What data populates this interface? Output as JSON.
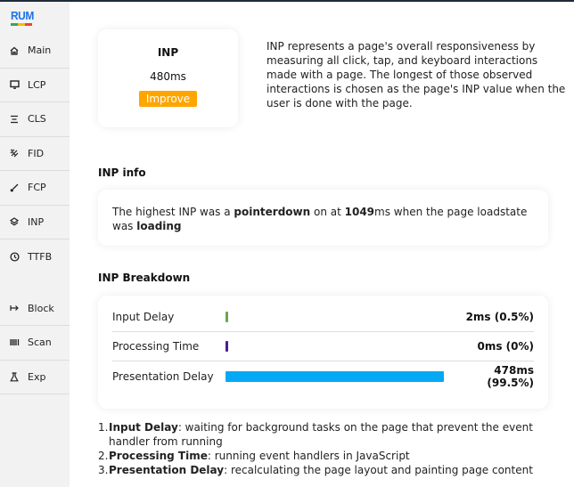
{
  "app": {
    "logo": "RUM",
    "logo_colors": [
      "#34a853",
      "#fbbc05",
      "#ea4335"
    ]
  },
  "sidebar": {
    "items": [
      {
        "label": "Main",
        "icon": "home-icon"
      },
      {
        "label": "LCP",
        "icon": "monitor-icon"
      },
      {
        "label": "CLS",
        "icon": "align-icon"
      },
      {
        "label": "FID",
        "icon": "pointer-icon"
      },
      {
        "label": "FCP",
        "icon": "brush-icon"
      },
      {
        "label": "INP",
        "icon": "layers-icon"
      },
      {
        "label": "TTFB",
        "icon": "clock-icon"
      },
      {
        "label": "Block",
        "icon": "arrow-right-bar-icon"
      },
      {
        "label": "Scan",
        "icon": "barcode-icon"
      },
      {
        "label": "Exp",
        "icon": "flask-icon"
      }
    ]
  },
  "metric": {
    "title": "INP",
    "value": "480ms",
    "button": "Improve",
    "button_color": "#ffa500"
  },
  "description": "INP represents a page's overall responsiveness by measuring all click, tap, and keyboard interactions made with a page. The longest of those observed interactions is chosen as the page's INP value when the user is done with the page.",
  "info": {
    "title": "INP info",
    "text_1": "The highest INP was a ",
    "event": "pointerdown",
    "text_2": " on at ",
    "time": "1049",
    "text_3": "ms when the page loadstate was ",
    "loadstate": "loading"
  },
  "breakdown": {
    "title": "INP Breakdown",
    "rows": [
      {
        "label": "Input Delay",
        "value": "2ms (0.5%)",
        "percent": 0.5,
        "color": "#6aa84f"
      },
      {
        "label": "Processing Time",
        "value": "0ms (0%)",
        "percent": 0,
        "color": "#4b1c8c"
      },
      {
        "label": "Presentation Delay",
        "value": "478ms (99.5%)",
        "percent": 99.5,
        "color": "#03a9f4"
      }
    ]
  },
  "legend": [
    {
      "num": "1.",
      "term": "Input Delay",
      "text": ": waiting for background tasks on the page that prevent the event handler from running"
    },
    {
      "num": "2.",
      "term": "Processing Time",
      "text": ": running event handlers in JavaScript"
    },
    {
      "num": "3.",
      "term": "Presentation Delay",
      "text": ": recalculating the page layout and painting page content"
    }
  ]
}
